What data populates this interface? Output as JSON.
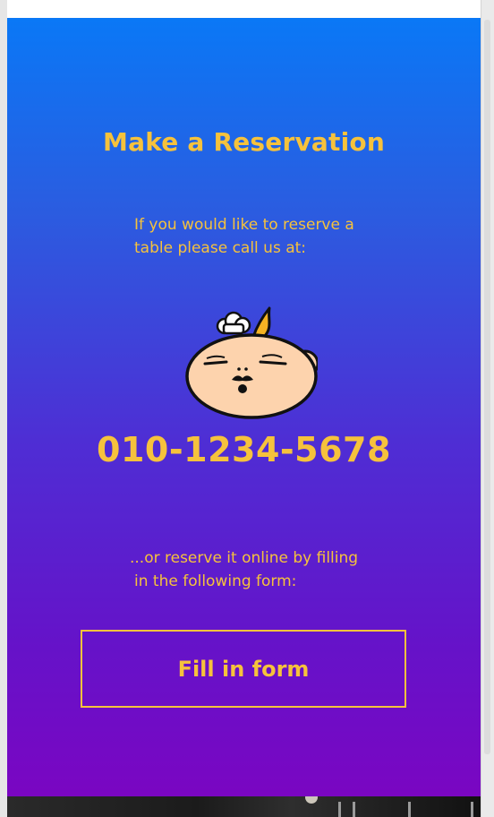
{
  "page": {
    "title": "Make a Reservation",
    "intro_text": "If you would like to reserve a table please call us at:",
    "phone": "010-1234-5678",
    "online_line1": "...or reserve it online by filling",
    "online_line2": "in the following form:",
    "form_button_label": "Fill in form"
  },
  "colors": {
    "accent": "#f6c23c",
    "gradient_top": "#0a78f6",
    "gradient_bottom": "#7a06c2"
  },
  "icons": {
    "mascot": "chef-baby-mascot-icon"
  }
}
